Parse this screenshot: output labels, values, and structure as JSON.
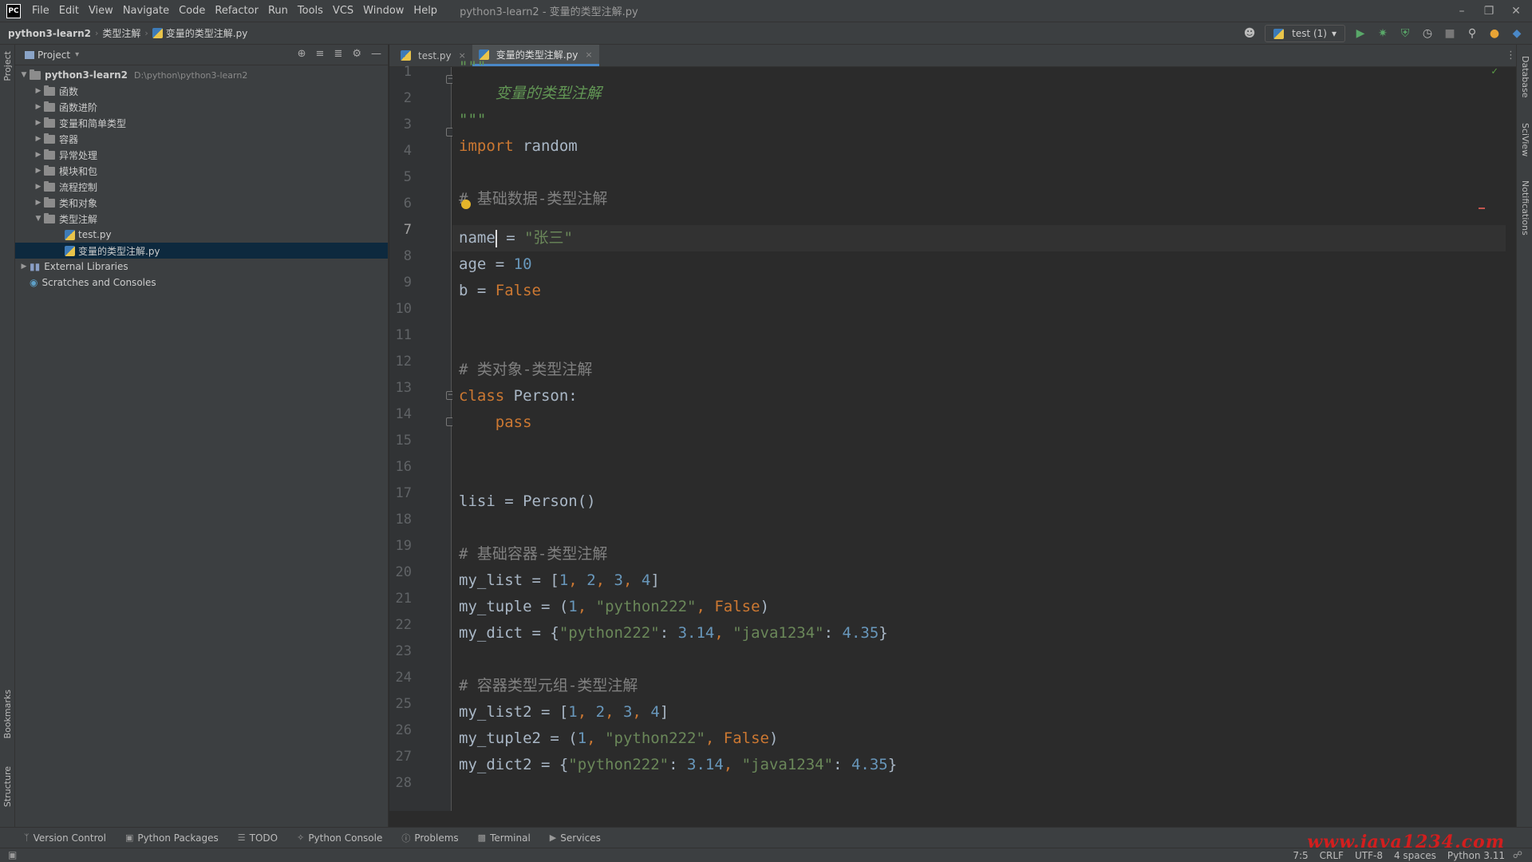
{
  "app": {
    "logo_text": "PC",
    "window_title": "python3-learn2 - 变量的类型注解.py",
    "menu": [
      "File",
      "Edit",
      "View",
      "Navigate",
      "Code",
      "Refactor",
      "Run",
      "Tools",
      "VCS",
      "Window",
      "Help"
    ]
  },
  "navbar": {
    "crumbs": [
      "python3-learn2",
      "类型注解",
      "变量的类型注解.py"
    ],
    "run_config": "test (1)"
  },
  "left_strip": {
    "project_label": "Project",
    "bookmarks_label": "Bookmarks",
    "structure_label": "Structure"
  },
  "right_strip": {
    "database_label": "Database",
    "sciview_label": "SciView",
    "notifications_label": "Notifications"
  },
  "project_panel": {
    "title": "Project",
    "root": {
      "name": "python3-learn2",
      "path": "D:\\python\\python3-learn2"
    },
    "folders": [
      "函数",
      "函数进阶",
      "变量和简单类型",
      "容器",
      "异常处理",
      "模块和包",
      "流程控制",
      "类和对象",
      "类型注解"
    ],
    "files": [
      "test.py",
      "变量的类型注解.py"
    ],
    "external_libraries": "External Libraries",
    "scratches": "Scratches and Consoles"
  },
  "editor": {
    "tabs": [
      {
        "label": "test.py",
        "active": false
      },
      {
        "label": "变量的类型注解.py",
        "active": true
      }
    ],
    "current_line": 7,
    "line_numbers": [
      "1",
      "2",
      "3",
      "4",
      "5",
      "6",
      "7",
      "8",
      "9",
      "10",
      "11",
      "12",
      "13",
      "14",
      "15",
      "16",
      "17",
      "18",
      "19",
      "20",
      "21",
      "22",
      "23",
      "24",
      "25",
      "26",
      "27",
      "28"
    ],
    "code": {
      "l1": "\"\"\"",
      "l2": "    变量的类型注解",
      "l3": "\"\"\"",
      "l4_kw": "import",
      "l4_rest": " random",
      "l6": "# 基础数据-类型注解",
      "l7_a": "name",
      "l7_b": " = ",
      "l7_c": "\"张三\"",
      "l8_a": "age = ",
      "l8_b": "10",
      "l9_a": "b = ",
      "l9_b": "False",
      "l12": "# 类对象-类型注解",
      "l13_kw": "class",
      "l13_rest": " Person:",
      "l14": "    pass",
      "l17": "lisi = Person()",
      "l19": "# 基础容器-类型注解",
      "l20_a": "my_list = [",
      "l20_n1": "1",
      "l20_n2": "2",
      "l20_n3": "3",
      "l20_n4": "4",
      "l20_e": "]",
      "l21_a": "my_tuple = (",
      "l21_n": "1",
      "l21_s": "\"python222\"",
      "l21_k": "False",
      "l21_e": ")",
      "l22_a": "my_dict = {",
      "l22_s1": "\"python222\"",
      "l22_n1": "3.14",
      "l22_s2": "\"java1234\"",
      "l22_n2": "4.35",
      "l22_e": "}",
      "l24": "# 容器类型元组-类型注解",
      "l25_a": "my_list2 = [",
      "l25_n1": "1",
      "l25_n2": "2",
      "l25_n3": "3",
      "l25_n4": "4",
      "l25_e": "]",
      "l26_a": "my_tuple2 = (",
      "l26_n": "1",
      "l26_s": "\"python222\"",
      "l26_k": "False",
      "l26_e": ")",
      "l27_a": "my_dict2 = {",
      "l27_s1": "\"python222\"",
      "l27_n1": "3.14",
      "l27_s2": "\"java1234\"",
      "l27_n2": "4.35",
      "l27_e": "}"
    }
  },
  "bottom_tabs": [
    "Version Control",
    "Python Packages",
    "TODO",
    "Python Console",
    "Problems",
    "Terminal",
    "Services"
  ],
  "status_bar": {
    "caret_position": "7:5",
    "line_separator": "CRLF",
    "encoding": "UTF-8",
    "indent": "4 spaces",
    "interpreter": "Python 3.11"
  },
  "watermark": "www.java1234.com",
  "colors": {
    "keyword": "#cc7832",
    "string": "#6a8759",
    "number": "#6897bb",
    "comment": "#808080",
    "docstring": "#629755",
    "selection": "#0d293e",
    "accent": "#4a88c7"
  }
}
